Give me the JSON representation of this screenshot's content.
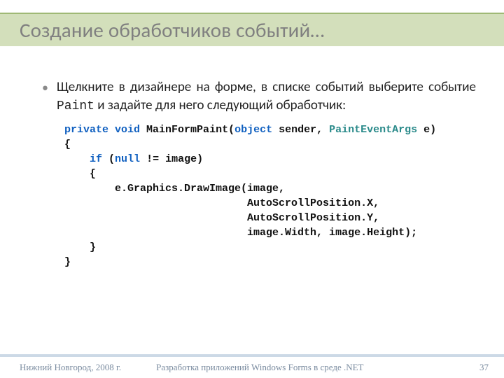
{
  "title": "Создание обработчиков событий…",
  "bullet": {
    "prefix": "Щелкните в дизайнере на форме, в списке событий выберите событие ",
    "mono": "Paint",
    "suffix": " и задайте для него следующий обработчик:"
  },
  "code": {
    "kw_private": "private",
    "kw_void": "void",
    "method": " MainFormPaint(",
    "kw_object": "object",
    "sender": " sender, ",
    "cls_args": "PaintEventArgs",
    "after_args": " e)",
    "l2": "{",
    "l3a": "    ",
    "kw_if": "if",
    "l3b": " (",
    "kw_null": "null",
    "l3c": " != image)",
    "l4": "    {",
    "l5": "        e.Graphics.DrawImage(image,",
    "l6": "                             AutoScrollPosition.X,",
    "l7": "                             AutoScrollPosition.Y,",
    "l8": "                             image.Width, image.Height);",
    "l9": "    }",
    "l10": "}"
  },
  "footer": {
    "left": "Нижний Новгород, 2008 г.",
    "center": "Разработка приложений Windows Forms в среде .NET",
    "page": "37"
  }
}
